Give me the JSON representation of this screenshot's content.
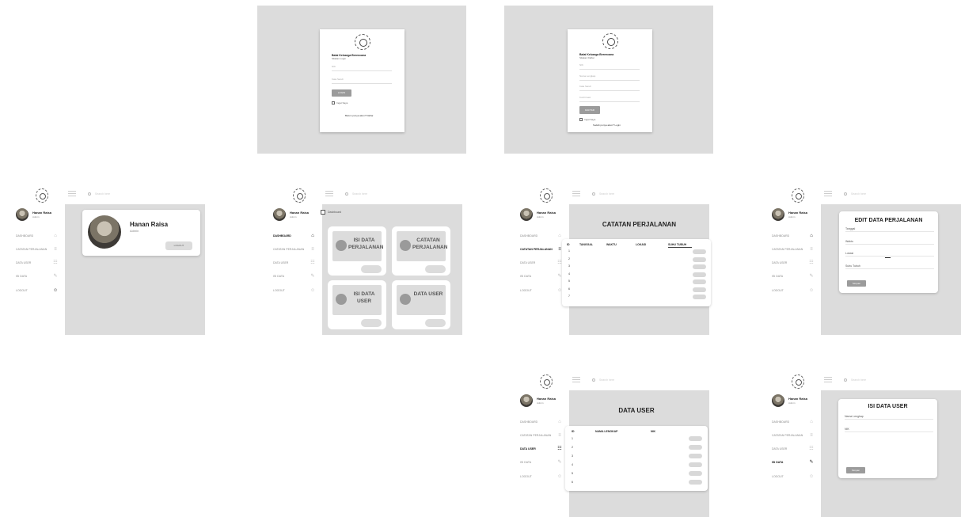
{
  "login1": {
    "org": "Balai Keluarga Berencana",
    "subtitle": "Silakan Login",
    "nik_placeholder": "NIK",
    "password_placeholder": "Kata Sandi",
    "button": "LOGIN",
    "remember": "Ingat Saya",
    "link": "Belum punya akun? Daftar"
  },
  "login2": {
    "org": "Balai Keluarga Berencana",
    "subtitle": "Silakan Daftar",
    "nik_placeholder": "NIK",
    "name_placeholder": "Nama Lengkap",
    "password_placeholder": "Kata Sandi",
    "confirm_placeholder": "Konfirmasi",
    "button": "DAFTAR",
    "remember": "Ingat Saya",
    "link": "Sudah punya akun? Login"
  },
  "sidebar": {
    "user_name": "Hanan Raisa",
    "user_role": "Admin",
    "search_placeholder": "Search here",
    "items": [
      "DASHBOARD",
      "CATATAN PERJALANAN",
      "DATA USER",
      "ISI DATA",
      "LOGOUT"
    ]
  },
  "profile": {
    "name": "Hanan Raisa",
    "role": "Admin",
    "logout": "LOGOUT"
  },
  "dashboard": {
    "breadcrumb": "Dashboard",
    "tiles": [
      {
        "label": "ISI DATA PERJALANAN"
      },
      {
        "label": "CATATAN PERJALANAN"
      },
      {
        "label": "ISI DATA USER"
      },
      {
        "label": "DATA USER"
      }
    ]
  },
  "catatan": {
    "title": "CATATAN PERJALANAN",
    "columns": [
      "ID",
      "TANGGAL",
      "WAKTU",
      "LOKASI",
      "SUHU TUBUH"
    ],
    "rows": [
      "1",
      "2",
      "3",
      "4",
      "5",
      "6",
      "7"
    ]
  },
  "edit": {
    "title": "EDIT DATA PERJALANAN",
    "fields": [
      "Tanggal",
      "Waktu",
      "Lokasi",
      "Suhu Tubuh"
    ],
    "button": "Simpan"
  },
  "datauser": {
    "title": "DATA USER",
    "columns": [
      "ID",
      "NAMA LENGKAP",
      "NIK"
    ],
    "rows": [
      "1",
      "2",
      "3",
      "4",
      "5",
      "6"
    ]
  },
  "isiuser": {
    "title": "ISI DATA USER",
    "fields": [
      "Nama Lengkap",
      "NIK"
    ],
    "button": "Simpan"
  }
}
